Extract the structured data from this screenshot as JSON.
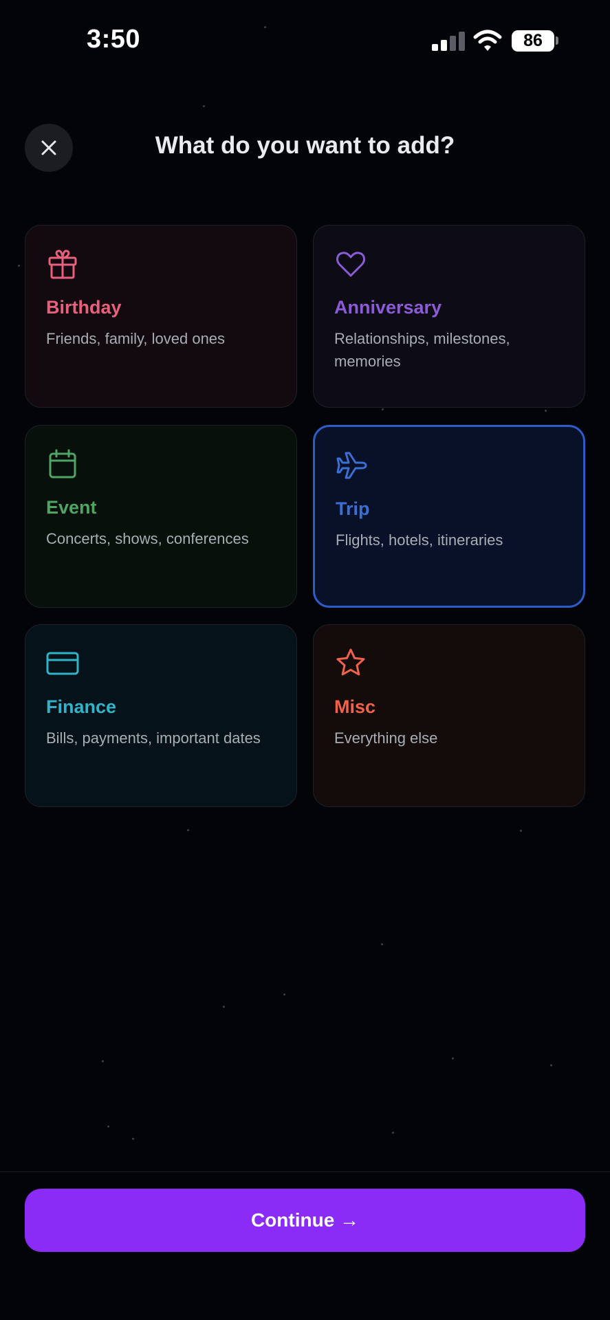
{
  "status_bar": {
    "time": "3:50",
    "battery": "86"
  },
  "header": {
    "title": "What do you want to add?",
    "close_icon": "close-icon"
  },
  "colors": {
    "birthday": "#e8607d",
    "anniversary": "#8b5cd6",
    "event": "#4fa563",
    "trip": "#3b6fd4",
    "finance": "#2fb4c9",
    "misc": "#f0624a",
    "selected_border": "#2d5cc8",
    "continue_button": "#8a2cf5"
  },
  "categories": [
    {
      "label": "Birthday",
      "description": "Friends, family, loved ones",
      "icon": "gift-icon",
      "selected": false
    },
    {
      "label": "Anniversary",
      "description": "Relationships, milestones, memories",
      "icon": "heart-icon",
      "selected": false
    },
    {
      "label": "Event",
      "description": "Concerts, shows, conferences",
      "icon": "calendar-icon",
      "selected": false
    },
    {
      "label": "Trip",
      "description": "Flights, hotels, itineraries",
      "icon": "airplane-icon",
      "selected": true
    },
    {
      "label": "Finance",
      "description": "Bills, payments, important dates",
      "icon": "credit-card-icon",
      "selected": false
    },
    {
      "label": "Misc",
      "description": "Everything else",
      "icon": "star-icon",
      "selected": false
    }
  ],
  "footer": {
    "continue_label": "Continue →"
  }
}
